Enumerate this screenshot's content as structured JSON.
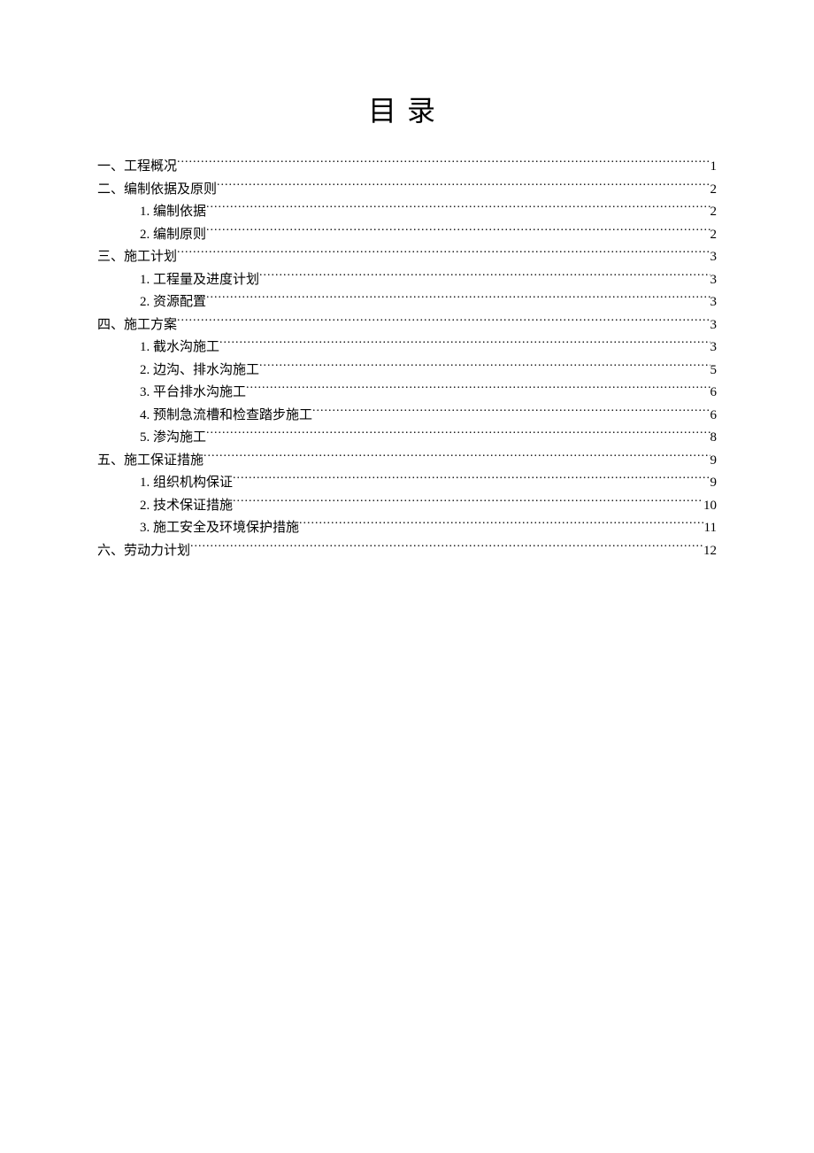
{
  "title": "目录",
  "entries": [
    {
      "level": 1,
      "label": "一、工程概况",
      "page": "1"
    },
    {
      "level": 1,
      "label": "二、编制依据及原则",
      "page": "2"
    },
    {
      "level": 2,
      "label": "1. 编制依据",
      "page": "2"
    },
    {
      "level": 2,
      "label": "2. 编制原则",
      "page": "2"
    },
    {
      "level": 1,
      "label": "三、施工计划",
      "page": "3"
    },
    {
      "level": 2,
      "label": "1. 工程量及进度计划",
      "page": "3"
    },
    {
      "level": 2,
      "label": "2. 资源配置",
      "page": "3"
    },
    {
      "level": 1,
      "label": "四、施工方案",
      "page": "3"
    },
    {
      "level": 2,
      "label": "1. 截水沟施工",
      "page": "3"
    },
    {
      "level": 2,
      "label": "2. 边沟、排水沟施工",
      "page": "5"
    },
    {
      "level": 2,
      "label": "3. 平台排水沟施工",
      "page": "6"
    },
    {
      "level": 2,
      "label": "4. 预制急流槽和检查踏步施工",
      "page": "6"
    },
    {
      "level": 2,
      "label": "5. 渗沟施工",
      "page": "8"
    },
    {
      "level": 1,
      "label": "五、施工保证措施",
      "page": "9"
    },
    {
      "level": 2,
      "label": "1. 组织机构保证",
      "page": "9"
    },
    {
      "level": 2,
      "label": "2. 技术保证措施",
      "page": "10"
    },
    {
      "level": 2,
      "label": "3. 施工安全及环境保护措施",
      "page": "11"
    },
    {
      "level": 1,
      "label": "六、劳动力计划",
      "page": "12"
    }
  ]
}
